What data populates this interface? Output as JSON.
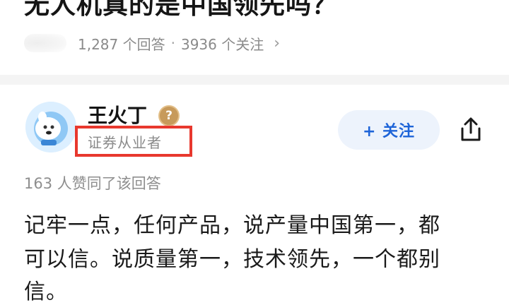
{
  "question": {
    "title": "无人机真的是中国领先吗？",
    "answer_count": "1,287 个回答",
    "separator": "·",
    "follow_count": "3936 个关注",
    "chevron": "›"
  },
  "answer": {
    "author": {
      "name": "王火丁",
      "badge": "?",
      "title": "证券从业者"
    },
    "follow_label": "+ 关注",
    "likes": "163 人赞同了该回答",
    "text_lines": [
      "记牢一点，任何产品，说产量中国第一，都",
      "可以信。说质量第一，技术领先，一个都别",
      "信。"
    ]
  },
  "colors": {
    "highlight_box": "#e8382e",
    "follow_button_text": "#1e64d8",
    "follow_button_bg": "#edf3fc",
    "badge": "#c79a5b"
  },
  "icons": {
    "share": "share-icon",
    "avatar": "avatar"
  }
}
